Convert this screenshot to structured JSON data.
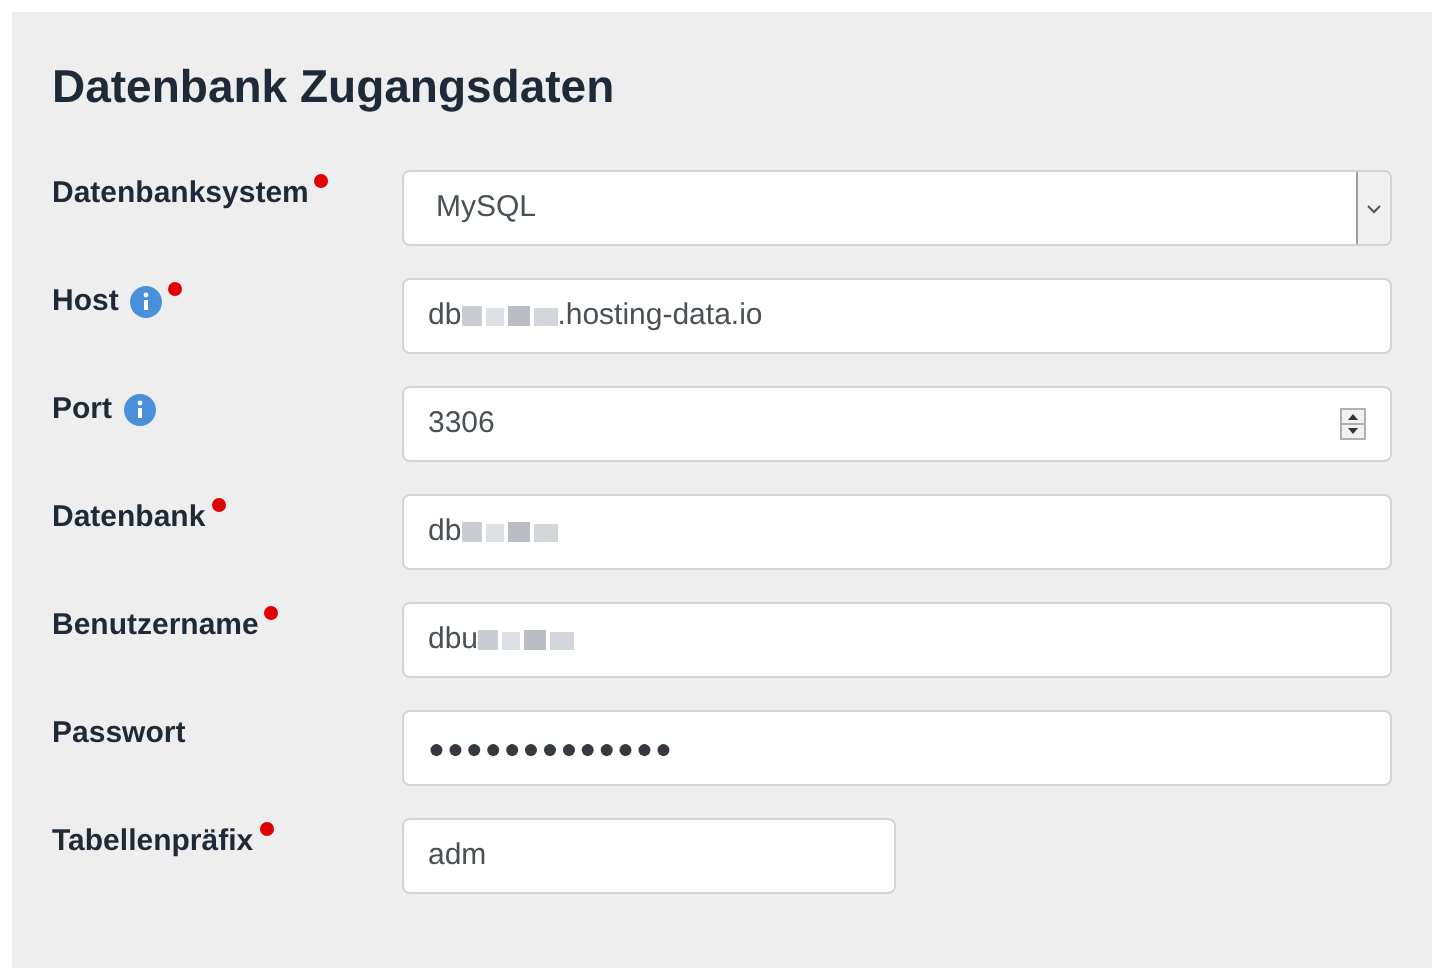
{
  "title": "Datenbank Zugangsdaten",
  "fields": [
    {
      "label": "Datenbanksystem",
      "kind": "select",
      "value": "MySQL",
      "required": true,
      "info": false
    },
    {
      "label": "Host",
      "kind": "text",
      "value": "db",
      "redacted": true,
      "suffix": ".hosting-data.io",
      "required": true,
      "info": true
    },
    {
      "label": "Port",
      "kind": "number",
      "value": "3306",
      "required": false,
      "info": true
    },
    {
      "label": "Datenbank",
      "kind": "text",
      "value": "db",
      "redacted": true,
      "required": true,
      "info": false
    },
    {
      "label": "Benutzername",
      "kind": "text",
      "value": "dbu",
      "redacted": true,
      "required": true,
      "info": false
    },
    {
      "label": "Passwort",
      "kind": "password",
      "value": "●●●●●●●●●●●●●",
      "required": false,
      "info": false
    },
    {
      "label": "Tabellenpräfix",
      "kind": "short",
      "value": "adm",
      "required": true,
      "info": false
    }
  ]
}
